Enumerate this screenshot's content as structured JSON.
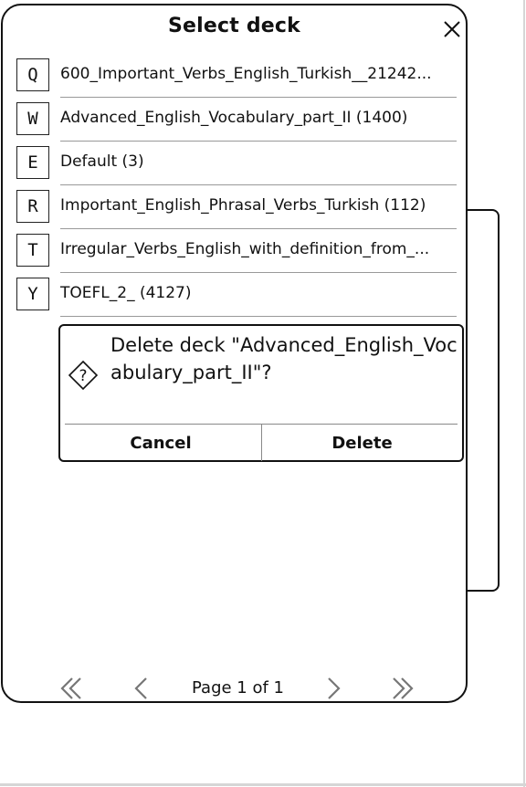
{
  "dialog": {
    "title": "Select deck"
  },
  "decks": [
    {
      "key": "Q",
      "label": "600_Important_Verbs_English_Turkish__21242..."
    },
    {
      "key": "W",
      "label": "Advanced_English_Vocabulary_part_II (1400)"
    },
    {
      "key": "E",
      "label": "Default (3)"
    },
    {
      "key": "R",
      "label": "Important_English_Phrasal_Verbs_Turkish (112)"
    },
    {
      "key": "T",
      "label": "Irregular_Verbs_English_with_definition_from_..."
    },
    {
      "key": "Y",
      "label": "TOEFL_2_ (4127)"
    }
  ],
  "confirm": {
    "message": "Delete deck \"Advanced_English_Vocabulary_part_II\"?",
    "cancel_label": "Cancel",
    "delete_label": "Delete"
  },
  "pager": {
    "label": "Page 1 of 1"
  },
  "icons": {
    "close": "close-icon",
    "question": "question-diamond-icon",
    "first": "double-chevron-left-icon",
    "prev": "chevron-left-icon",
    "next": "chevron-right-icon",
    "last": "double-chevron-right-icon"
  }
}
